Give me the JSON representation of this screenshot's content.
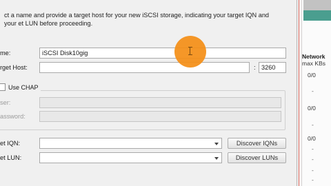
{
  "dialog": {
    "instructions": "ct a name and provide a target host for your new iSCSI storage, indicating your target IQN and your et LUN before proceeding.",
    "name_label": "me:",
    "name_value": "iSCSI Disk10gig",
    "host_label": "rget Host:",
    "host_value": "",
    "port_separator": ":",
    "port_value": "3260",
    "chap_label": "Use CHAP",
    "chap_user_label": "ser:",
    "chap_password_label": "assword:",
    "iqn_label": "et IQN:",
    "lun_label": "et LUN:",
    "discover_iqns": "Discover IQNs",
    "discover_luns": "Discover LUNs"
  },
  "background_window": {
    "network_header": "Network",
    "network_sub": "max KBs",
    "rows": [
      "0/0",
      "-",
      "0/0",
      "-",
      "0/0",
      "-",
      "-",
      "-",
      "-",
      "-",
      "-"
    ]
  }
}
